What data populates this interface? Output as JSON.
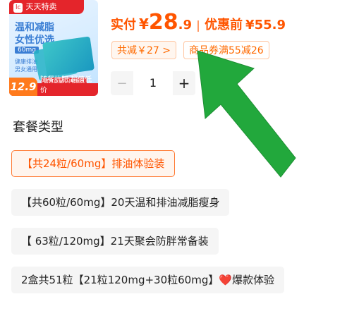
{
  "product_image": {
    "brand_tag": "天天特卖",
    "brand_logo": "lc",
    "slogan_line1": "温和减脂",
    "slogan_line2": "女性优选",
    "spec": "60mg",
    "bullet1": "健康排油",
    "bullet2": "男女通用",
    "official": "官方正品 闪电发货",
    "badge_price": "12.9",
    "bottom_text": "随餐抗肥 超值低价"
  },
  "price": {
    "actual_label": "实付",
    "currency": "¥",
    "actual_int": "28",
    "actual_dec": ".9",
    "promo_label": "优惠前",
    "promo_price": "¥55.9"
  },
  "discount_chip": "共减￥27 >",
  "coupon_chip": "商品券满55减26",
  "stepper": {
    "minus": "−",
    "quantity": "1",
    "plus": "+"
  },
  "section_title": "套餐类型",
  "options": [
    {
      "label": "【共24粒/60mg】排油体验装",
      "selected": true
    },
    {
      "label": "【共60粒/60mg】20天温和排油减脂瘦身",
      "selected": false
    },
    {
      "label": "【 63粒/120mg】21天聚会防胖常备装",
      "selected": false
    },
    {
      "label_before_heart": "2盒共51粒【21粒120mg+30粒60mg】",
      "heart": "❤️",
      "label_after_heart": "爆款体验",
      "selected": false
    }
  ],
  "colors": {
    "accent": "#ff5500",
    "arrow": "#22a83c"
  }
}
